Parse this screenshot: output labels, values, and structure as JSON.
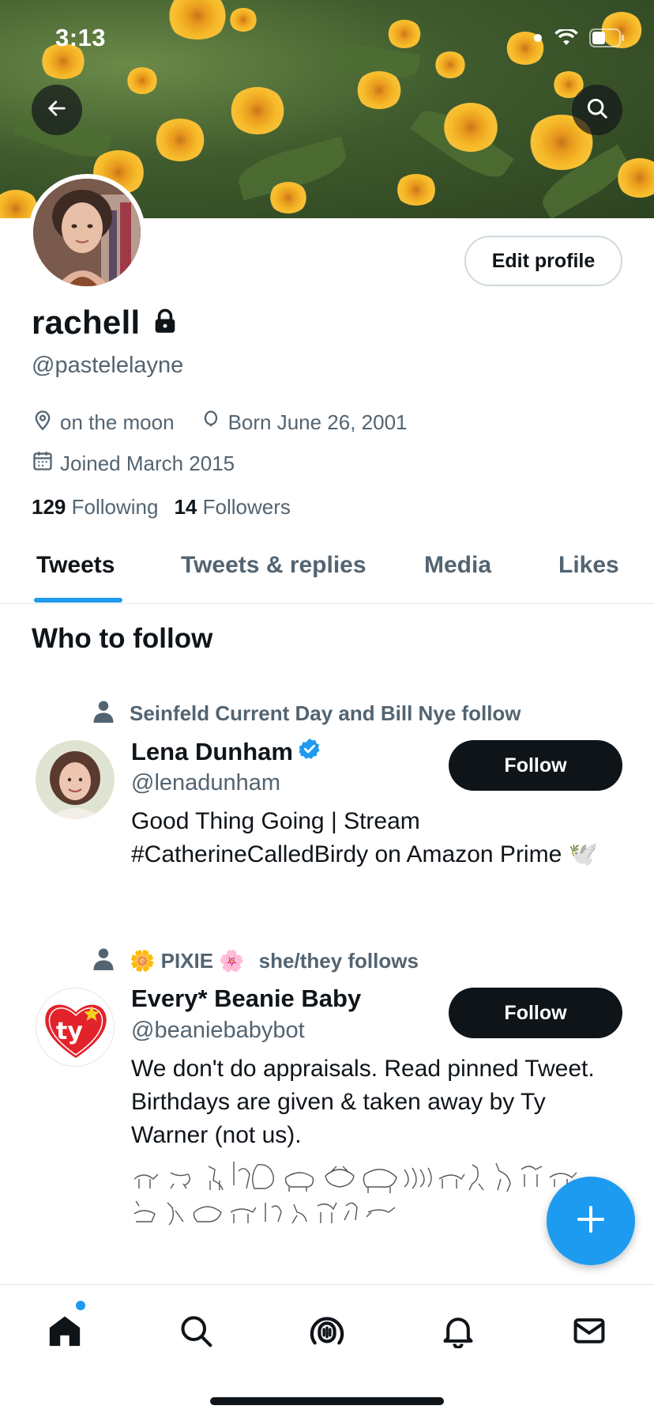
{
  "status_bar": {
    "time": "3:13"
  },
  "profile": {
    "name": "rachell",
    "handle": "@pastelelayne",
    "location": "on the moon",
    "birthday": "Born June 26, 2001",
    "joined": "Joined March 2015",
    "following_count": "129",
    "following_label": "Following",
    "followers_count": "14",
    "followers_label": "Followers",
    "edit_label": "Edit profile"
  },
  "tabs": [
    {
      "label": "Tweets",
      "active": true
    },
    {
      "label": "Tweets & replies"
    },
    {
      "label": "Media"
    },
    {
      "label": "Likes"
    }
  ],
  "who_to_follow": {
    "title": "Who to follow",
    "suggestions": [
      {
        "context": "Seinfeld Current Day and Bill Nye follow",
        "name": "Lena Dunham",
        "verified": true,
        "handle": "@lenadunham",
        "bio": "Good Thing Going | Stream #CatherineCalledBirdy on Amazon Prime 🕊️",
        "follow_label": "Follow"
      },
      {
        "context_prefix": "🌼 PIXIE 🌸",
        "context": "she/they follows",
        "name": "Every* Beanie Baby",
        "verified": false,
        "handle": "@beaniebabybot",
        "bio": "We don't do appraisals. Read pinned Tweet. Birthdays are given & taken away by Ty Warner (not us).",
        "follow_label": "Follow",
        "avatar_text": "ty"
      }
    ]
  },
  "colors": {
    "accent": "#1d9bf0",
    "text": "#0f1419",
    "secondary": "#536471"
  },
  "icons": [
    "back-arrow-icon",
    "search-icon",
    "lock-icon",
    "location-icon",
    "balloon-icon",
    "calendar-icon",
    "person-icon",
    "verified-badge-icon",
    "compose-plus-icon",
    "home-icon",
    "explore-icon",
    "spaces-icon",
    "bell-icon",
    "mail-icon"
  ]
}
